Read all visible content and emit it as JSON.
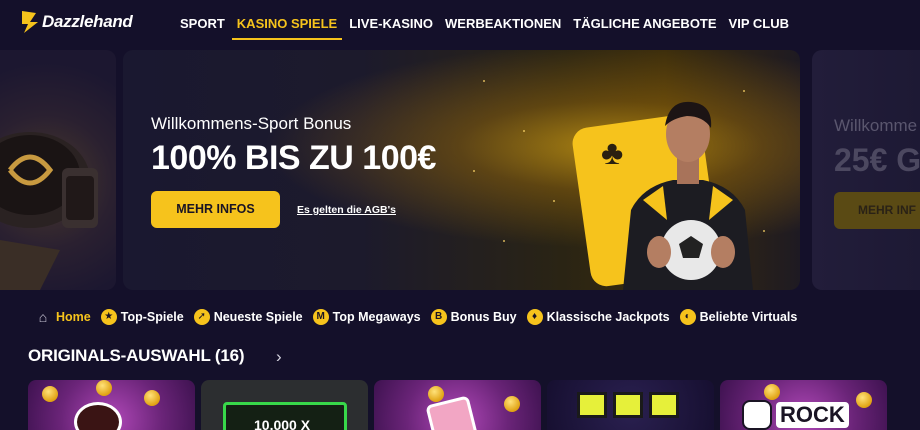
{
  "brand": {
    "logo_text": "Dazzlehand"
  },
  "nav": {
    "items": [
      {
        "label": "SPORT",
        "active": false
      },
      {
        "label": "KASINO SPIELE",
        "active": true
      },
      {
        "label": "LIVE-KASINO",
        "active": false
      },
      {
        "label": "WERBEAKTIONEN",
        "active": false
      },
      {
        "label": "TÄGLICHE ANGEBOTE",
        "active": false
      },
      {
        "label": "VIP CLUB",
        "active": false
      }
    ]
  },
  "carousel": {
    "main": {
      "subtitle": "Willkommens-Sport Bonus",
      "title": "100% BIS ZU 100€",
      "button_label": "MEHR INFOS",
      "terms_link": "Es gelten die AGB's"
    },
    "next": {
      "subtitle": "Willkomme",
      "title": "25€ G",
      "button_label": "MEHR INF"
    }
  },
  "categories": [
    {
      "label": "Home",
      "icon": "home-icon",
      "active": true
    },
    {
      "label": "Top-Spiele",
      "icon": "star-icon"
    },
    {
      "label": "Neueste Spiele",
      "icon": "rocket-icon"
    },
    {
      "label": "Top Megaways",
      "icon": "megaways-icon"
    },
    {
      "label": "Bonus Buy",
      "icon": "bonus-buy-icon"
    },
    {
      "label": "Klassische Jackpots",
      "icon": "jackpot-icon"
    },
    {
      "label": "Beliebte Virtuals",
      "icon": "virtuals-icon"
    }
  ],
  "section": {
    "title": "ORIGINALS-AUSWAHL (16)"
  },
  "games": [
    {
      "name": "bomb-game"
    },
    {
      "name": "10000-game",
      "text": "10.000 X"
    },
    {
      "name": "dice-game"
    },
    {
      "name": "blocks-game"
    },
    {
      "name": "rock-game",
      "text": "ROCK"
    }
  ],
  "colors": {
    "accent": "#f6c31c",
    "background": "#14102a"
  }
}
